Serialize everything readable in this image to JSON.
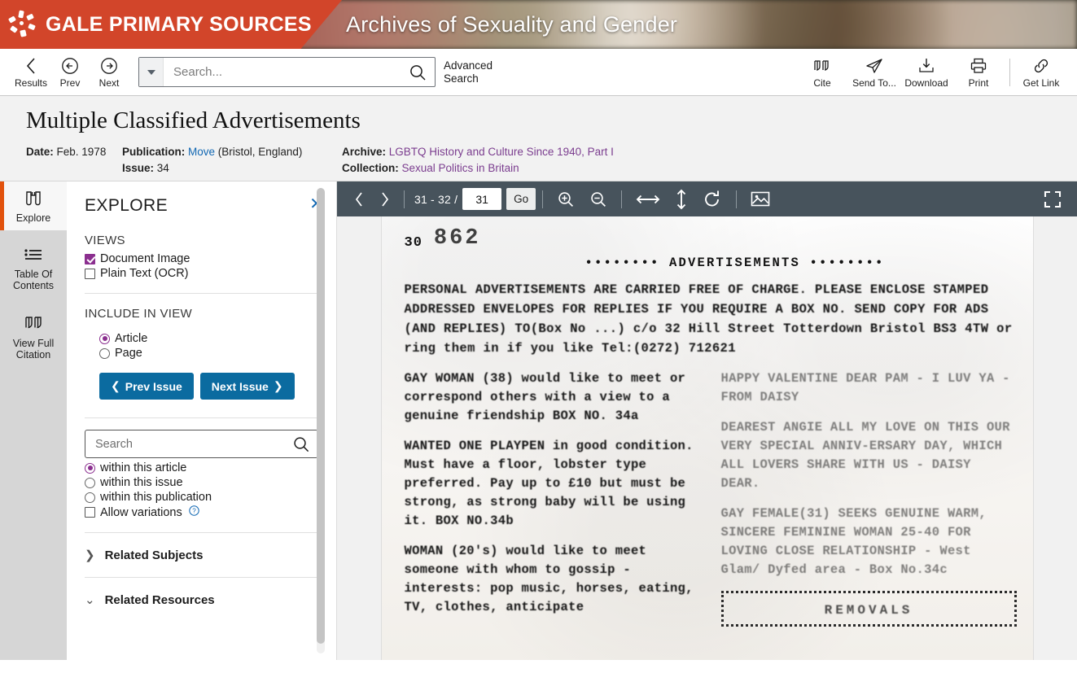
{
  "banner": {
    "brand": "GALE PRIMARY SOURCES",
    "subtitle": "Archives of Sexuality and Gender",
    "brand_color": "#d2452a",
    "logo_icon": "gale-starburst-icon"
  },
  "toolbar": {
    "results_label": "Results",
    "prev_label": "Prev",
    "next_label": "Next",
    "search_placeholder": "Search...",
    "search_value": "",
    "search_icon": "magnifier-icon",
    "dropdown_icon": "chevron-down-icon",
    "advanced_search_line1": "Advanced",
    "advanced_search_line2": "Search",
    "actions": [
      {
        "label": "Cite",
        "icon": "quote-icon"
      },
      {
        "label": "Send To...",
        "icon": "paper-plane-icon"
      },
      {
        "label": "Download",
        "icon": "download-icon"
      },
      {
        "label": "Print",
        "icon": "printer-icon"
      },
      {
        "label": "Get Link",
        "icon": "link-chain-icon"
      }
    ]
  },
  "document_header": {
    "title": "Multiple Classified Advertisements",
    "date_label": "Date:",
    "date_value": "Feb. 1978",
    "publication_label": "Publication:",
    "publication_link": "Move",
    "publication_place": "(Bristol, England)",
    "issue_label": "Issue:",
    "issue_value": "34",
    "archive_label": "Archive:",
    "archive_link": "LGBTQ History and Culture Since 1940, Part I",
    "collection_label": "Collection:",
    "collection_link": "Sexual Politics in Britain"
  },
  "rail": {
    "items": [
      {
        "label": "Explore",
        "icon": "binoculars-icon",
        "active": true
      },
      {
        "label": "Table Of Contents",
        "icon": "list-icon",
        "active": false
      },
      {
        "label": "View Full Citation",
        "icon": "quote-icon",
        "active": false
      }
    ]
  },
  "explore_panel": {
    "title": "EXPLORE",
    "close_icon": "close-x-icon",
    "views_label": "VIEWS",
    "views": [
      {
        "label": "Document Image",
        "checked": true
      },
      {
        "label": "Plain Text (OCR)",
        "checked": false
      }
    ],
    "include_label": "INCLUDE IN VIEW",
    "include_options": [
      {
        "label": "Article",
        "selected": true
      },
      {
        "label": "Page",
        "selected": false
      }
    ],
    "prev_issue_label": "Prev Issue",
    "next_issue_label": "Next Issue",
    "search_placeholder": "Search",
    "search_value": "",
    "search_icon": "magnifier-icon",
    "scope_options": [
      {
        "label": "within this article",
        "selected": true
      },
      {
        "label": "within this issue",
        "selected": false
      },
      {
        "label": "within this publication",
        "selected": false
      }
    ],
    "allow_variations_label": "Allow variations",
    "allow_variations_checked": false,
    "help_icon": "question-circle-icon",
    "accordions": [
      {
        "label": "Related Subjects",
        "expanded": false,
        "icon": "chevron-right-icon"
      },
      {
        "label": "Related Resources",
        "expanded": true,
        "icon": "chevron-down-icon"
      }
    ],
    "accent_color": "#8b2f8f",
    "button_color": "#0b6ba0"
  },
  "viewer": {
    "prev_page_icon": "chevron-left-icon",
    "next_page_icon": "chevron-right-icon",
    "page_range": "31 - 32 /",
    "page_input_value": "31",
    "go_label": "Go",
    "zoom_in_icon": "magnifier-plus-icon",
    "zoom_out_icon": "magnifier-minus-icon",
    "fit_width_icon": "arrows-horizontal-icon",
    "fit_height_icon": "arrows-vertical-icon",
    "rotate_icon": "rotate-cw-icon",
    "thumbnail_icon": "image-icon",
    "fullscreen_icon": "fullscreen-expand-icon",
    "toolbar_color": "#47535c"
  },
  "scan": {
    "page_number_small": "30",
    "page_number_large": "862",
    "ad_heading": "•••••••• ADVERTISEMENTS ••••••••",
    "notice": "PERSONAL ADVERTISEMENTS ARE CARRIED FREE OF CHARGE.  PLEASE ENCLOSE STAMPED ADDRESSED ENVELOPES FOR REPLIES IF YOU REQUIRE A BOX NO. SEND COPY FOR ADS (AND REPLIES) TO(Box No ...) c/o 32 Hill Street Totterdown  Bristol BS3 4TW or ring them in if you like Tel:(0272) 712621",
    "left_column": [
      "GAY WOMAN (38) would like to meet or correspond others with a view to a genuine friendship BOX NO. 34a",
      "WANTED ONE PLAYPEN in good condition.  Must have a floor, lobster type preferred.  Pay up to £10 but must be strong, as strong baby will be using it.  BOX NO.34b",
      "WOMAN (20's) would like to meet someone with whom to gossip - interests: pop music, horses, eating, TV, clothes, anticipate"
    ],
    "right_column": [
      "HAPPY VALENTINE DEAR PAM - I LUV YA - FROM DAISY",
      "DEAREST ANGIE ALL MY LOVE ON THIS OUR VERY SPECIAL ANNIV-ERSARY DAY, WHICH ALL LOVERS SHARE WITH US - DAISY DEAR.",
      "GAY FEMALE(31) SEEKS GENUINE WARM, SINCERE FEMININE WOMAN 25-40 FOR LOVING CLOSE RELATIONSHIP - West Glam/ Dyfed area - Box No.34c"
    ],
    "boxed_text": "REMOVALS"
  }
}
